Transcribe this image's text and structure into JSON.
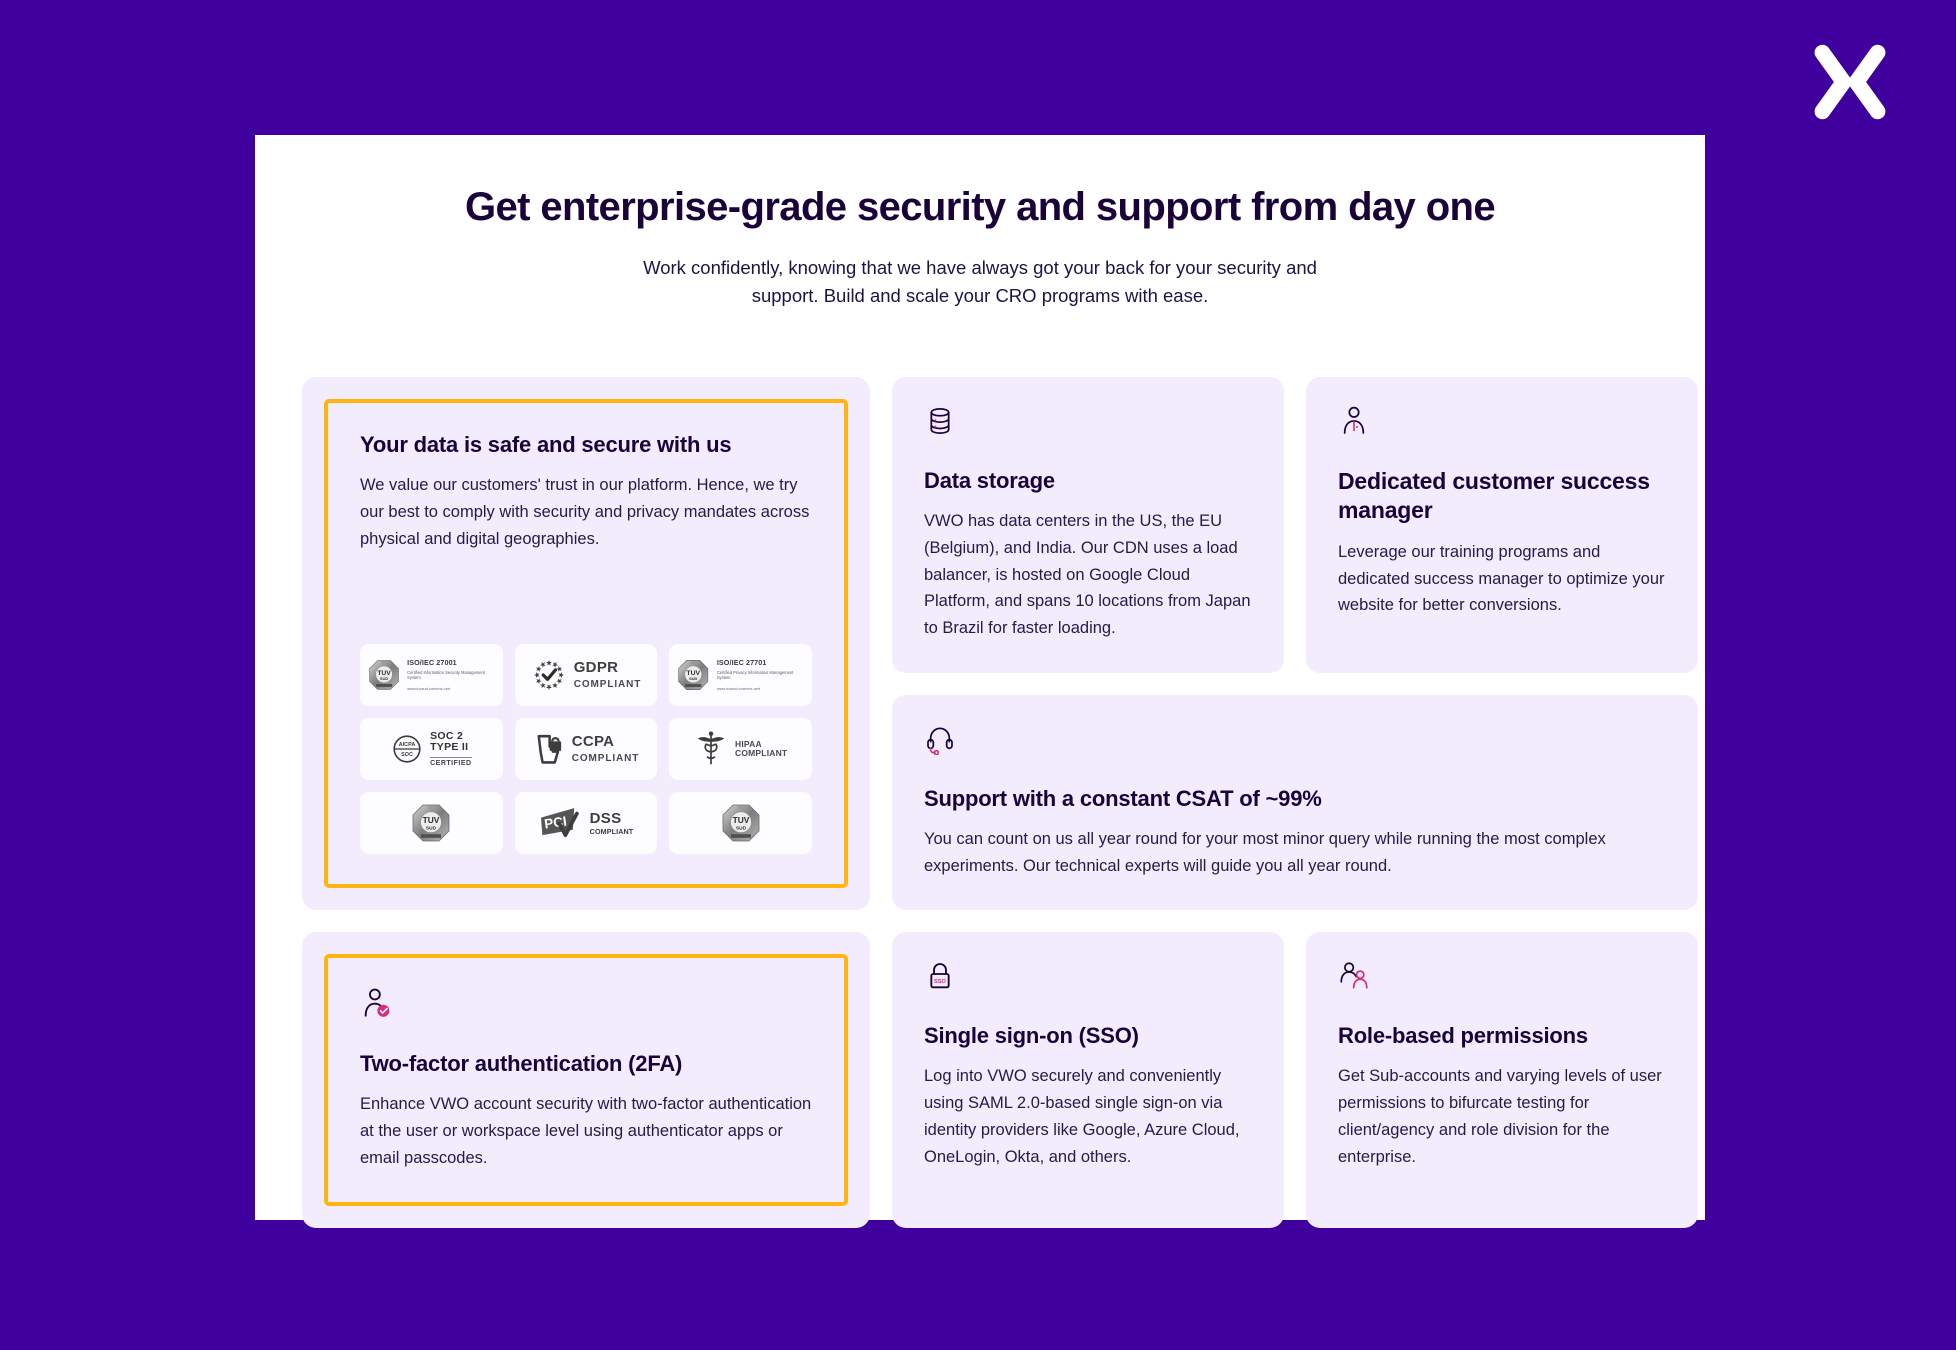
{
  "brand": {
    "logo_name": "vwo-x-logo",
    "background_color": "#3F009E",
    "panel_color": "#FFFFFF",
    "card_color": "#F2ECFD",
    "accent_color": "#FFB511",
    "heading_color": "#190339",
    "icon_accent_color": "#E0267A"
  },
  "header": {
    "title": "Get enterprise-grade security and support from day one",
    "subtitle": "Work confidently, knowing that we have always got your back for your security and support. Build and scale your CRO programs with ease."
  },
  "cards": {
    "data_safe": {
      "title": "Your data is safe and secure with us",
      "body": "We value our customers' trust in our platform. Hence, we try our best to comply with security and privacy mandates across physical and digital geographies.",
      "highlighted": true
    },
    "two_factor": {
      "icon": "user-check-icon",
      "title": "Two-factor authentication (2FA)",
      "body": "Enhance VWO account security with two-factor authentication at the user or workspace level using authenticator apps or email passcodes.",
      "highlighted": true
    },
    "data_storage": {
      "icon": "database-icon",
      "title": "Data storage",
      "body": "VWO has data centers in the US, the EU (Belgium), and India. Our CDN uses a load balancer, is hosted on Google Cloud Platform, and spans 10 locations from Japan to Brazil for faster loading."
    },
    "success_manager": {
      "icon": "person-icon",
      "title": "Dedicated customer success manager",
      "body": "Leverage our training programs and dedicated success manager to optimize your website for better conversions."
    },
    "support_csat": {
      "icon": "headset-icon",
      "title": "Support with a constant CSAT of ~99%",
      "body": "You can count on us all year round for your most minor query while running the most complex experiments. Our technical experts will guide you all year round."
    },
    "sso": {
      "icon": "lock-sso-icon",
      "icon_label": "SSO",
      "title": "Single sign-on (SSO)",
      "body": "Log into VWO securely and conveniently using SAML 2.0-based single sign-on via identity providers like Google, Azure Cloud, OneLogin, Okta, and others."
    },
    "role_permissions": {
      "icon": "two-people-icon",
      "title": "Role-based permissions",
      "body": "Get Sub-accounts and varying levels of user permissions to bifurcate testing for client/agency and role division for the enterprise."
    }
  },
  "badges": [
    {
      "id": "iso-27001",
      "icon": "tuv-sud-octagon-icon",
      "mark": "TUV",
      "mark_sub": "SUD",
      "main": "ISO/IEC 27001",
      "sub": "Certified Information Security Management System",
      "url": "www.tuvsud.com/ms-cert"
    },
    {
      "id": "gdpr",
      "icon": "eu-stars-check-icon",
      "main": "GDPR",
      "sub": "COMPLIANT"
    },
    {
      "id": "iso-27701",
      "icon": "tuv-sud-octagon-icon",
      "mark": "TUV",
      "mark_sub": "SUD",
      "main": "ISO/IEC 27701",
      "sub": "Certified Privacy Information Management System",
      "url": "www.tuvsud.com/ms-cert"
    },
    {
      "id": "soc2",
      "icon": "aicpa-soc-icon",
      "mark": "AICPA",
      "mark_sub": "SOC",
      "main": "SOC 2",
      "main2": "TYPE II",
      "sub": "CERTIFIED"
    },
    {
      "id": "ccpa",
      "icon": "california-lock-icon",
      "main": "CCPA",
      "sub": "COMPLIANT"
    },
    {
      "id": "hipaa",
      "icon": "caduceus-icon",
      "main": "HIPAA",
      "sub": "COMPLIANT"
    },
    {
      "id": "tuv-sud-left",
      "icon": "tuv-sud-octagon-icon",
      "mark": "TUV",
      "mark_sub": "SUD"
    },
    {
      "id": "pci-dss",
      "icon": "pci-icon",
      "main": "DSS",
      "sub": "COMPLIANT"
    },
    {
      "id": "tuv-sud-right",
      "icon": "tuv-sud-octagon-icon",
      "mark": "TUV",
      "mark_sub": "SUD"
    }
  ]
}
